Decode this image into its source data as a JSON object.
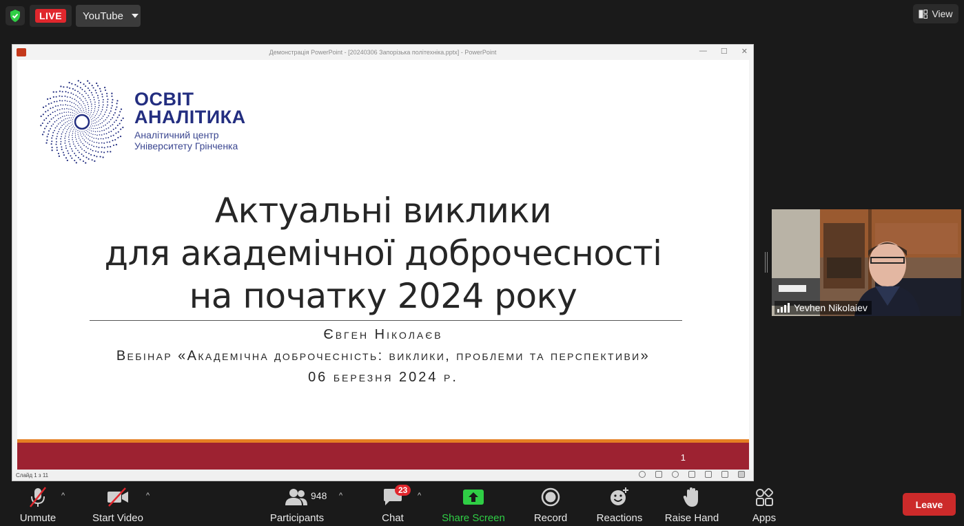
{
  "topbar": {
    "live_label": "LIVE",
    "stream_target": "YouTube",
    "view_label": "View",
    "accent_live": "#e0272d",
    "shield_color": "#2fce45"
  },
  "ppt": {
    "window_title": "Демонстрація PowerPoint - [20240306 Запорізька політехніка.pptx] - PowerPoint",
    "status_text": "Слайд 1 з 11",
    "slide": {
      "brand_line1": "ОСВІТ",
      "brand_line2": "АНАЛІТИКА",
      "brand_line3": "Аналітичний центр",
      "brand_line4": "Університету Грінченка",
      "title_line1": "Актуальні виклики",
      "title_line2": "для академічної доброчесності",
      "title_line3": "на початку 2024 року",
      "author": "Євген Ніколаєв",
      "event": "Вебінар «Академічна доброчесність: виклики, проблеми та перспективи»",
      "date": "06 березня 2024 р.",
      "slide_number": "1",
      "brand_color": "#232e80",
      "band_color": "#9d2231",
      "stripe_color": "#e57f23"
    }
  },
  "participant": {
    "name": "Yevhen Nikolaiev"
  },
  "toolbar": {
    "unmute": "Unmute",
    "start_video": "Start Video",
    "participants": "Participants",
    "participants_count": "948",
    "chat": "Chat",
    "chat_badge": "23",
    "share_screen": "Share Screen",
    "record": "Record",
    "reactions": "Reactions",
    "raise_hand": "Raise Hand",
    "apps": "Apps",
    "leave": "Leave",
    "share_color": "#2fce45"
  }
}
